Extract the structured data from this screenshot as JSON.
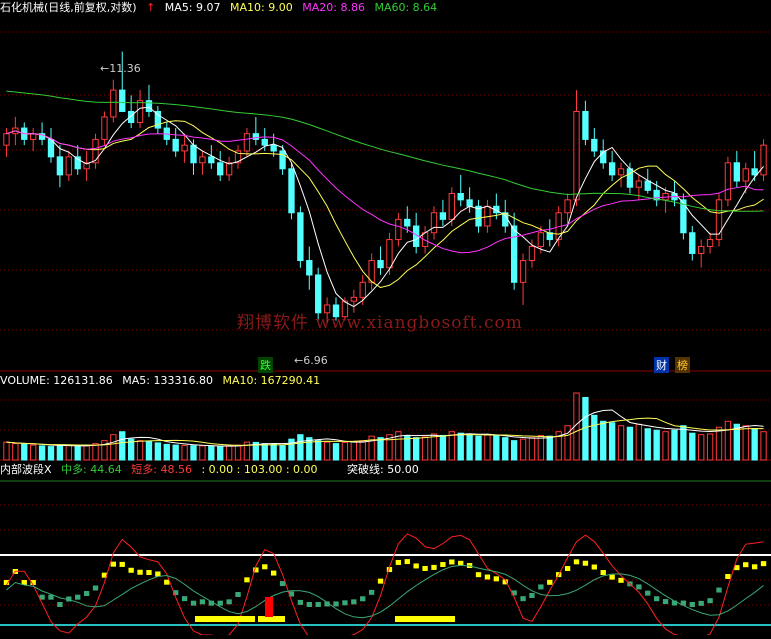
{
  "colors": {
    "bg": "#000000",
    "up": "#FF3B3B",
    "down": "#54FFFF",
    "ma5": "#FFFFFF",
    "ma10": "#FFFF55",
    "ma20": "#FF33FF",
    "ma60": "#33CC33",
    "grid": "#7a0000",
    "panel_border": "#8a0000"
  },
  "price_panel": {
    "title": "石化机械(日线,前复权,对数)",
    "ma5": "MA5: 9.07",
    "ma10": "MA10: 9.00",
    "ma20": "MA20: 8.86",
    "ma60": "MA60: 8.64",
    "high_label": "11.36",
    "low_label": "6.96",
    "badges": [
      {
        "text": "跌"
      },
      {
        "text": "财"
      },
      {
        "text": "榜"
      }
    ]
  },
  "volume_panel": {
    "volume": "VOLUME: 126131.86",
    "ma5": "MA5: 133316.80",
    "ma10": "MA10: 167290.41"
  },
  "indicator_panel": {
    "name": "内部波段X",
    "mid": "中多: 44.64",
    "short": "短多: 48.56",
    "values": ": 0.00 : 103.00 : 0.00",
    "breakthrough": "突破线: 50.00"
  },
  "watermark": "翔博软件 www.xiangbosoft.com",
  "chart_data": {
    "type": "candlestick",
    "price_high": 11.36,
    "price_low": 6.96,
    "ohlc": [
      [
        9.6,
        9.9,
        9.4,
        9.8
      ],
      [
        9.8,
        10.1,
        9.6,
        9.9
      ],
      [
        9.9,
        10.0,
        9.6,
        9.7
      ],
      [
        9.7,
        9.9,
        9.5,
        9.8
      ],
      [
        9.8,
        10.0,
        9.6,
        9.7
      ],
      [
        9.7,
        9.9,
        9.3,
        9.4
      ],
      [
        9.4,
        9.6,
        8.9,
        9.1
      ],
      [
        9.1,
        9.5,
        9.0,
        9.4
      ],
      [
        9.4,
        9.6,
        9.1,
        9.2
      ],
      [
        9.2,
        9.5,
        9.0,
        9.3
      ],
      [
        9.3,
        9.8,
        9.2,
        9.7
      ],
      [
        9.7,
        10.2,
        9.6,
        10.1
      ],
      [
        10.1,
        10.8,
        10.0,
        10.6
      ],
      [
        10.6,
        11.36,
        10.4,
        10.2
      ],
      [
        10.2,
        10.5,
        9.9,
        10.0
      ],
      [
        10.0,
        10.6,
        9.9,
        10.4
      ],
      [
        10.4,
        10.7,
        10.1,
        10.2
      ],
      [
        10.2,
        10.3,
        9.8,
        9.9
      ],
      [
        9.9,
        10.0,
        9.6,
        9.7
      ],
      [
        9.7,
        9.9,
        9.4,
        9.5
      ],
      [
        9.5,
        9.8,
        9.3,
        9.6
      ],
      [
        9.6,
        9.7,
        9.1,
        9.3
      ],
      [
        9.3,
        9.5,
        9.1,
        9.4
      ],
      [
        9.4,
        9.6,
        9.2,
        9.3
      ],
      [
        9.3,
        9.5,
        9.0,
        9.1
      ],
      [
        9.1,
        9.4,
        9.0,
        9.3
      ],
      [
        9.3,
        9.6,
        9.2,
        9.5
      ],
      [
        9.5,
        9.9,
        9.4,
        9.8
      ],
      [
        9.8,
        10.1,
        9.6,
        9.7
      ],
      [
        9.7,
        9.9,
        9.5,
        9.6
      ],
      [
        9.6,
        9.8,
        9.4,
        9.5
      ],
      [
        9.5,
        9.6,
        9.1,
        9.2
      ],
      [
        9.2,
        9.3,
        8.4,
        8.5
      ],
      [
        8.5,
        8.6,
        7.7,
        7.8
      ],
      [
        7.8,
        8.0,
        7.4,
        7.6
      ],
      [
        7.6,
        7.7,
        7.0,
        7.1
      ],
      [
        7.1,
        7.3,
        6.96,
        7.2
      ],
      [
        7.2,
        7.3,
        7.0,
        7.05
      ],
      [
        7.05,
        7.3,
        7.0,
        7.25
      ],
      [
        7.25,
        7.4,
        7.1,
        7.3
      ],
      [
        7.3,
        7.6,
        7.2,
        7.5
      ],
      [
        7.5,
        7.9,
        7.4,
        7.8
      ],
      [
        7.8,
        8.0,
        7.6,
        7.7
      ],
      [
        7.7,
        8.2,
        7.6,
        8.1
      ],
      [
        8.1,
        8.5,
        8.0,
        8.4
      ],
      [
        8.4,
        8.6,
        8.2,
        8.3
      ],
      [
        8.3,
        8.5,
        7.9,
        8.0
      ],
      [
        8.0,
        8.3,
        7.9,
        8.2
      ],
      [
        8.2,
        8.6,
        8.1,
        8.5
      ],
      [
        8.5,
        8.7,
        8.3,
        8.4
      ],
      [
        8.4,
        8.9,
        8.3,
        8.8
      ],
      [
        8.8,
        9.1,
        8.6,
        8.7
      ],
      [
        8.7,
        8.9,
        8.5,
        8.6
      ],
      [
        8.6,
        8.7,
        8.2,
        8.3
      ],
      [
        8.3,
        8.7,
        8.2,
        8.6
      ],
      [
        8.6,
        8.8,
        8.4,
        8.5
      ],
      [
        8.5,
        8.7,
        8.2,
        8.3
      ],
      [
        8.3,
        8.5,
        7.4,
        7.5
      ],
      [
        7.5,
        7.9,
        7.2,
        7.8
      ],
      [
        7.8,
        8.1,
        7.7,
        8.0
      ],
      [
        8.0,
        8.3,
        7.9,
        8.2
      ],
      [
        8.2,
        8.4,
        8.0,
        8.1
      ],
      [
        8.1,
        8.6,
        8.0,
        8.5
      ],
      [
        8.5,
        8.8,
        8.3,
        8.7
      ],
      [
        8.7,
        10.6,
        8.6,
        10.2
      ],
      [
        10.2,
        10.4,
        9.6,
        9.7
      ],
      [
        9.7,
        9.9,
        9.4,
        9.5
      ],
      [
        9.5,
        9.7,
        9.2,
        9.3
      ],
      [
        9.3,
        9.5,
        9.0,
        9.1
      ],
      [
        9.1,
        9.3,
        8.9,
        9.2
      ],
      [
        9.2,
        9.3,
        8.8,
        8.9
      ],
      [
        8.9,
        9.1,
        8.7,
        9.0
      ],
      [
        9.0,
        9.2,
        8.8,
        8.85
      ],
      [
        8.85,
        9.0,
        8.6,
        8.7
      ],
      [
        8.7,
        8.9,
        8.5,
        8.8
      ],
      [
        8.8,
        9.0,
        8.6,
        8.7
      ],
      [
        8.7,
        8.8,
        8.1,
        8.2
      ],
      [
        8.2,
        8.3,
        7.8,
        7.9
      ],
      [
        7.9,
        8.1,
        7.7,
        8.0
      ],
      [
        8.0,
        8.2,
        7.9,
        8.1
      ],
      [
        8.1,
        8.8,
        8.0,
        8.7
      ],
      [
        8.7,
        9.4,
        8.6,
        9.3
      ],
      [
        9.3,
        9.5,
        8.9,
        9.0
      ],
      [
        9.0,
        9.3,
        8.8,
        9.2
      ],
      [
        9.2,
        9.5,
        9.0,
        9.1
      ],
      [
        9.1,
        9.7,
        9.0,
        9.6
      ]
    ],
    "volume": [
      120,
      110,
      105,
      100,
      95,
      90,
      100,
      98,
      92,
      96,
      110,
      130,
      170,
      190,
      140,
      130,
      125,
      115,
      105,
      100,
      98,
      96,
      95,
      92,
      90,
      94,
      100,
      120,
      118,
      110,
      104,
      96,
      140,
      170,
      150,
      130,
      120,
      110,
      118,
      122,
      130,
      160,
      150,
      170,
      190,
      160,
      150,
      155,
      175,
      165,
      190,
      180,
      170,
      160,
      170,
      165,
      150,
      130,
      140,
      150,
      165,
      160,
      190,
      230,
      450,
      420,
      300,
      260,
      250,
      230,
      220,
      240,
      210,
      200,
      190,
      200,
      230,
      180,
      170,
      175,
      220,
      260,
      240,
      230,
      210,
      190
    ],
    "volume_max": 470
  }
}
